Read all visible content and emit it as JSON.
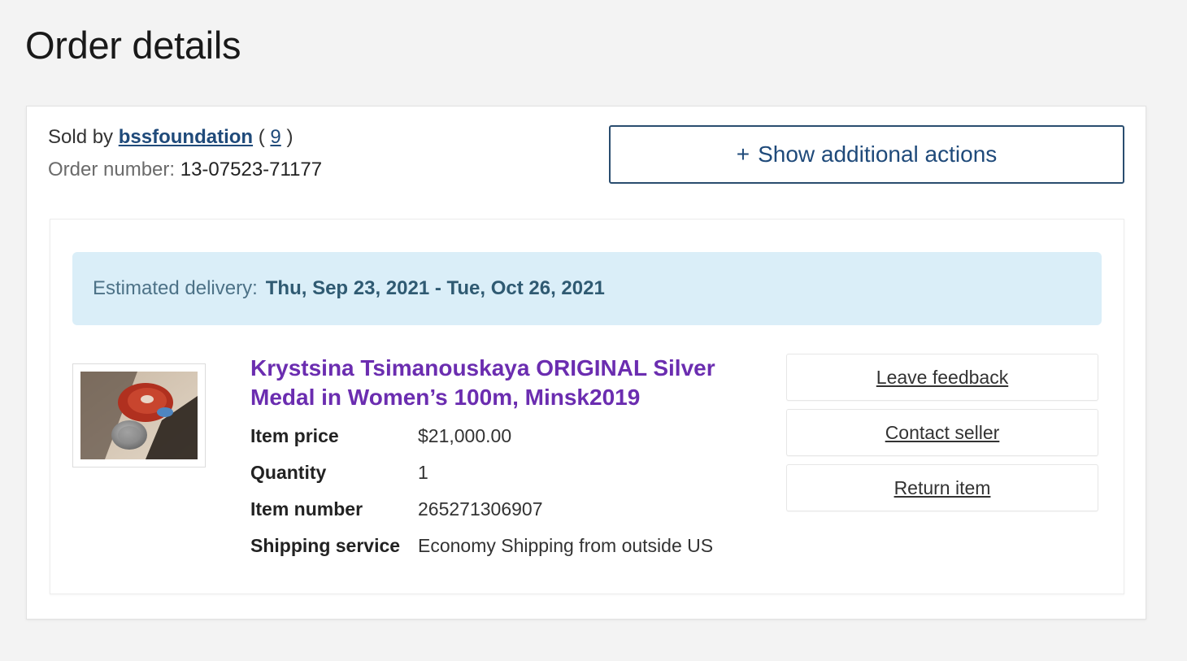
{
  "page": {
    "title": "Order details"
  },
  "seller": {
    "sold_by_label": "Sold by",
    "name": "bssfoundation",
    "open_paren": "(",
    "feedback_score": "9",
    "close_paren": ")"
  },
  "order": {
    "number_label": "Order number:",
    "number": "13-07523-71177"
  },
  "actions": {
    "plus": "+",
    "label": "Show additional actions"
  },
  "delivery": {
    "label": "Estimated delivery:",
    "dates": "Thu, Sep 23, 2021 - Tue, Oct 26, 2021"
  },
  "item": {
    "title": "Krystsina Tsimanouskaya ORIGINAL Silver Medal in Women’s 100m, Minsk2019",
    "specs": [
      {
        "label": "Item price",
        "value": "$21,000.00"
      },
      {
        "label": "Quantity",
        "value": "1"
      },
      {
        "label": "Item number",
        "value": "265271306907"
      },
      {
        "label": "Shipping service",
        "value": "Economy Shipping from outside US"
      }
    ]
  },
  "side_actions": [
    {
      "label": "Leave feedback"
    },
    {
      "label": "Contact seller"
    },
    {
      "label": "Return item"
    }
  ],
  "colors": {
    "link": "#1f4a7a",
    "item_title": "#6b2db0",
    "banner_bg": "#daeef8"
  }
}
